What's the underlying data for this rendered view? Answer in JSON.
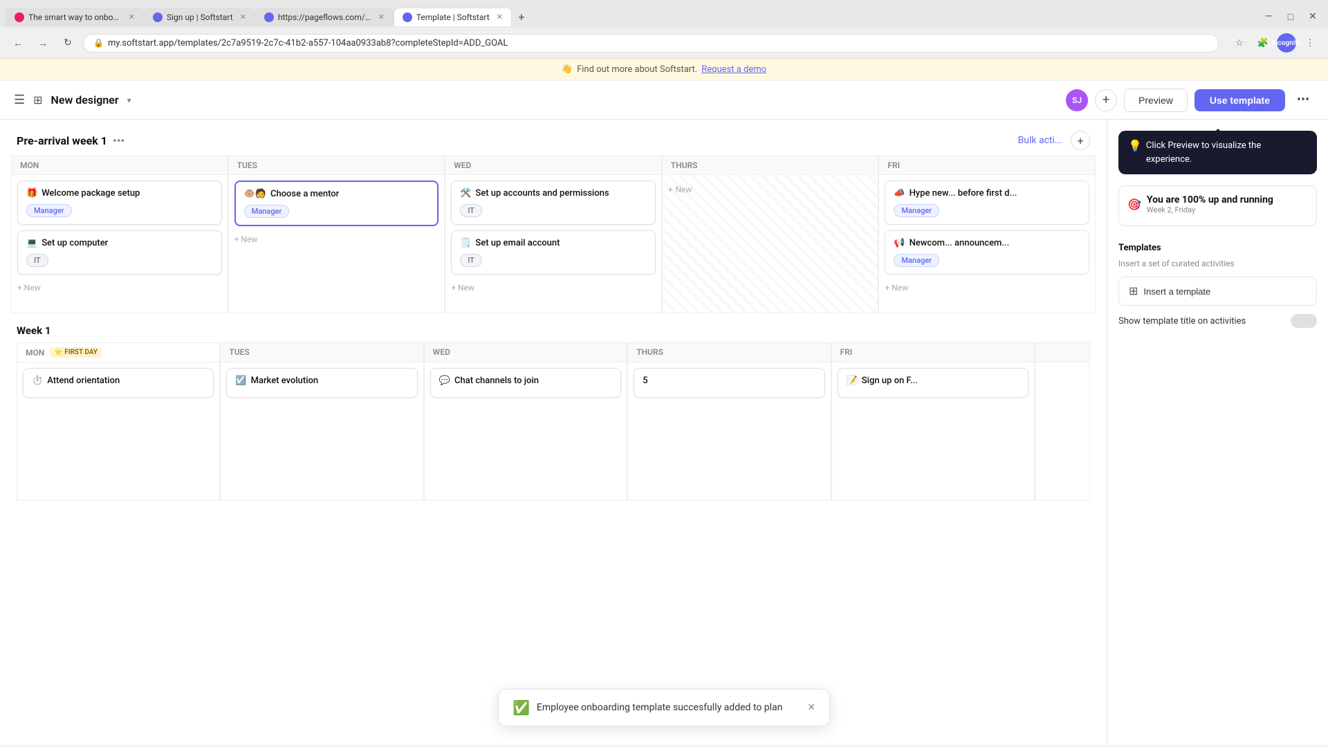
{
  "browser": {
    "tabs": [
      {
        "id": "tab1",
        "favicon_color": "#e91e63",
        "title": "The smart way to onboard new h...",
        "active": false
      },
      {
        "id": "tab2",
        "favicon_color": "#6366f1",
        "title": "Sign up | Softstart",
        "active": false
      },
      {
        "id": "tab3",
        "favicon_color": "#6366f1",
        "title": "https://pageflows.com/_emails/...",
        "active": false
      },
      {
        "id": "tab4",
        "favicon_color": "#6366f1",
        "title": "Template | Softstart",
        "active": true
      }
    ],
    "url": "my.softstart.app/templates/2c7a9519-2c7c-41b2-a557-104aa0933ab8?completeStepId=ADD_GOAL",
    "incognito_label": "Incognito"
  },
  "notification_bar": {
    "emoji": "👋",
    "text": "Find out more about Softstart.",
    "link": "Request a demo"
  },
  "header": {
    "title": "New designer",
    "avatar": "SJ",
    "preview_label": "Preview",
    "use_template_label": "Use template",
    "more_icon": "•••"
  },
  "tooltip": {
    "text": "Click Preview to visualize the experience."
  },
  "sections": {
    "pre_arrival": {
      "title": "Pre-arrival week 1",
      "dots": "•••",
      "bulk_action": "Bulk acti...",
      "days": [
        "Mon",
        "Tues",
        "Wed",
        "Thurs",
        "Fri"
      ],
      "cards": {
        "mon": [
          {
            "emoji": "🎁",
            "title": "Welcome package setup",
            "tag": "Manager",
            "tag_type": "manager"
          },
          {
            "emoji": "💻",
            "title": "Set up computer",
            "tag": "IT",
            "tag_type": "it"
          }
        ],
        "tues": [
          {
            "emoji": "🐵🧑",
            "title": "Choose a mentor",
            "tag": "Manager",
            "tag_type": "manager",
            "highlighted": true
          }
        ],
        "wed": [
          {
            "emoji": "🛠️",
            "title": "Set up accounts and permissions",
            "tag": "IT",
            "tag_type": "it"
          },
          {
            "emoji": "🗒️",
            "title": "Set up email account",
            "tag": "IT",
            "tag_type": "it"
          }
        ],
        "thurs": [],
        "fri": [
          {
            "emoji": "📣",
            "title": "Hype new... before first d...",
            "tag": "Manager",
            "tag_type": "manager",
            "partial": true
          },
          {
            "emoji": "📢",
            "title": "Newcom... announcem...",
            "tag": "Manager",
            "tag_type": "manager",
            "partial": true
          }
        ]
      },
      "new_label": "+ New"
    },
    "week1": {
      "title": "Week 1",
      "days": [
        "Mon",
        "Tues",
        "Wed",
        "Thurs"
      ],
      "first_day_label": "First day",
      "first_day_star": "⭐",
      "cards": {
        "mon": [
          {
            "emoji": "⏱️",
            "title": "Attend orientation"
          }
        ],
        "tues": [
          {
            "emoji": "☑️",
            "title": "Market evolution"
          }
        ],
        "wed": [
          {
            "emoji": "💬",
            "title": "Chat channels to join"
          }
        ],
        "thurs": [
          {
            "text": "5",
            "partial": true
          }
        ],
        "fri_partial": [
          {
            "emoji": "📝",
            "title": "Sign up on F..."
          }
        ]
      }
    }
  },
  "right_panel": {
    "progress": {
      "title": "You are 100% up and running",
      "subtitle": "Week 2, Friday"
    },
    "templates": {
      "title": "Templates",
      "description": "Insert a set of curated activities",
      "insert_label": "Insert a template",
      "show_title_label": "Show template title on activities"
    }
  },
  "snackbar": {
    "message": "Employee onboarding template succesfully added to plan",
    "icon": "✓"
  },
  "new_item": {
    "label": "New"
  }
}
